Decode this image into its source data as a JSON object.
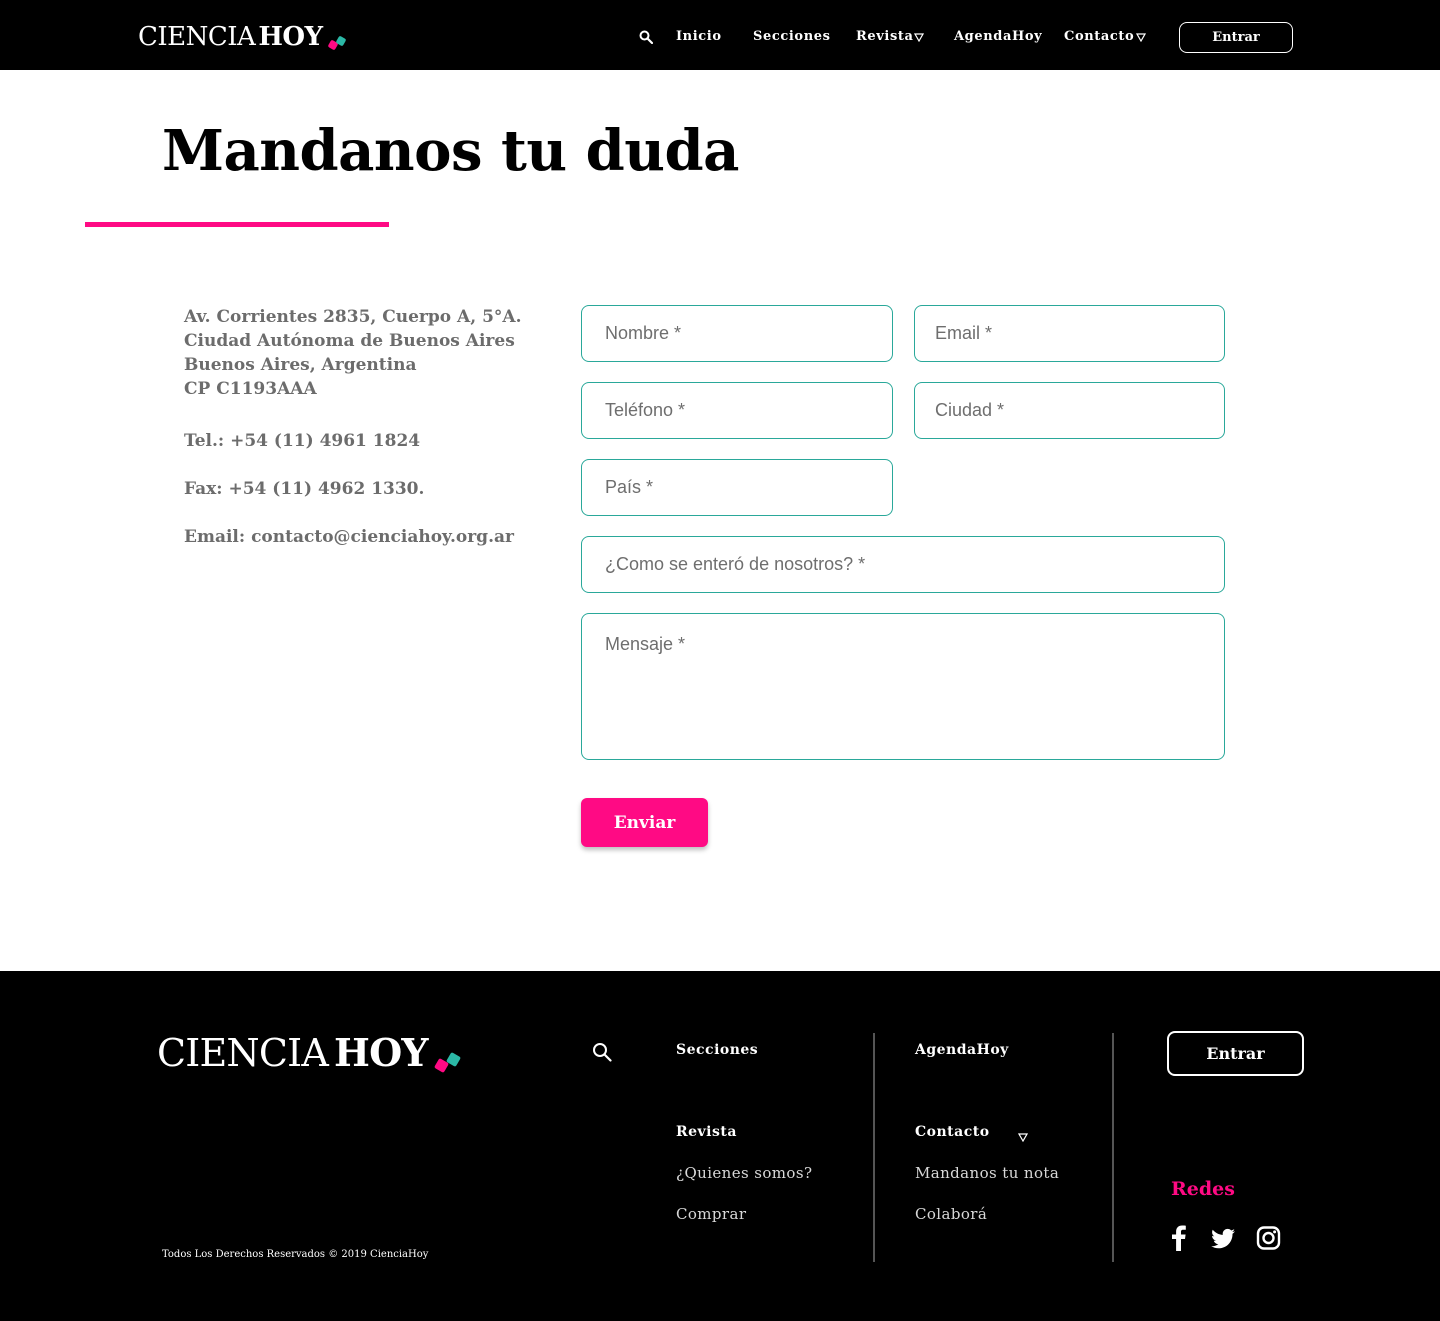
{
  "brand": {
    "word1": "CIENCIA",
    "word2": "HOY",
    "accent_pink": "#ff0a84",
    "accent_teal": "#2bb8a6"
  },
  "header": {
    "nav": [
      "Inicio",
      "Secciones",
      "Revista",
      "AgendaHoy",
      "Contacto"
    ],
    "login_label": "Entrar"
  },
  "page": {
    "title": "Mandanos tu duda"
  },
  "contact_info": {
    "address_lines": [
      "Av. Corrientes 2835, Cuerpo A, 5°A.",
      "Ciudad Autónoma de Buenos Aires",
      "Buenos Aires, Argentina",
      "CP C1193AAA"
    ],
    "phone": "Tel.: +54 (11) 4961 1824",
    "fax": "Fax: +54 (11) 4962 1330.",
    "email": "Email: contacto@cienciahoy.org.ar"
  },
  "form": {
    "nombre_placeholder": "Nombre *",
    "email_placeholder": "Email *",
    "telefono_placeholder": "Teléfono *",
    "ciudad_placeholder": "Ciudad *",
    "pais_placeholder": "País *",
    "como_placeholder": "¿Como se enteró de nosotros? *",
    "mensaje_placeholder": "Mensaje *",
    "submit_label": "Enviar",
    "field_border_color": "#2aa89a"
  },
  "footer": {
    "secciones": "Secciones",
    "agendahoy": "AgendaHoy",
    "revista": "Revista",
    "quienes_somos": "¿Quienes somos?",
    "comprar": "Comprar",
    "contacto": "Contacto",
    "mandanos_nota": "Mandanos tu nota",
    "colabora": "Colaborá",
    "login_label": "Entrar",
    "redes_label": "Redes",
    "social_icons": [
      "facebook-icon",
      "twitter-icon",
      "instagram-icon"
    ],
    "copyright": "Todos Los Derechos Reservados © 2019 CienciaHoy"
  }
}
